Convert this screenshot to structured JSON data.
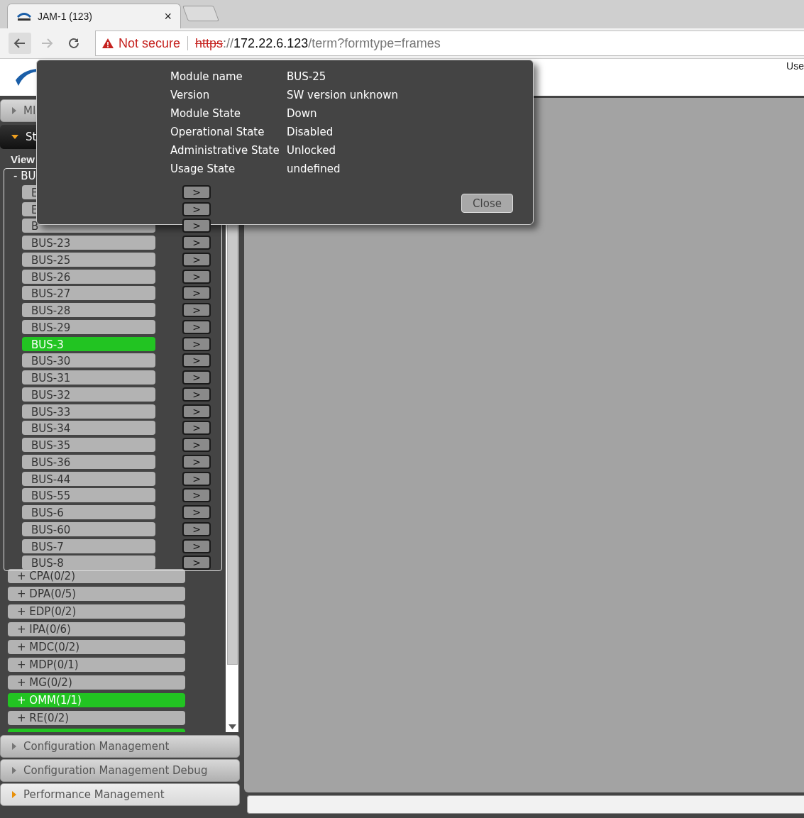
{
  "browser": {
    "tab": {
      "title": "JAM-1 (123)",
      "close": "×"
    },
    "address": {
      "warning": "Not secure",
      "scheme": "https",
      "separator": "://",
      "host": "172.22.6.123",
      "path": "/term?formtype=frames"
    }
  },
  "header": {
    "user_text": "Use"
  },
  "sidebar": {
    "sections_top": [
      {
        "label": "MI",
        "expanded": false
      },
      {
        "label": "St",
        "expanded": true
      }
    ],
    "view_label": "View",
    "tree": {
      "label": "- BU",
      "items": [
        {
          "label": "E",
          "action": ">",
          "selected": false
        },
        {
          "label": "E",
          "action": ">",
          "selected": false
        },
        {
          "label": "B",
          "action": ">",
          "selected": false
        },
        {
          "label": "BUS-23",
          "action": ">",
          "selected": false
        },
        {
          "label": "BUS-25",
          "action": ">",
          "selected": false
        },
        {
          "label": "BUS-26",
          "action": ">",
          "selected": false
        },
        {
          "label": "BUS-27",
          "action": ">",
          "selected": false
        },
        {
          "label": "BUS-28",
          "action": ">",
          "selected": false
        },
        {
          "label": "BUS-29",
          "action": ">",
          "selected": false
        },
        {
          "label": "BUS-3",
          "action": ">",
          "selected": true
        },
        {
          "label": "BUS-30",
          "action": ">",
          "selected": false
        },
        {
          "label": "BUS-31",
          "action": ">",
          "selected": false
        },
        {
          "label": "BUS-32",
          "action": ">",
          "selected": false
        },
        {
          "label": "BUS-33",
          "action": ">",
          "selected": false
        },
        {
          "label": "BUS-34",
          "action": ">",
          "selected": false
        },
        {
          "label": "BUS-35",
          "action": ">",
          "selected": false
        },
        {
          "label": "BUS-36",
          "action": ">",
          "selected": false
        },
        {
          "label": "BUS-44",
          "action": ">",
          "selected": false
        },
        {
          "label": "BUS-55",
          "action": ">",
          "selected": false
        },
        {
          "label": "BUS-6",
          "action": ">",
          "selected": false
        },
        {
          "label": "BUS-60",
          "action": ">",
          "selected": false
        },
        {
          "label": "BUS-7",
          "action": ">",
          "selected": false
        },
        {
          "label": "BUS-8",
          "action": ">",
          "selected": false
        }
      ]
    },
    "groups": [
      {
        "label": "+ CPA(0/2)",
        "selected": false
      },
      {
        "label": "+ DPA(0/5)",
        "selected": false
      },
      {
        "label": "+ EDP(0/2)",
        "selected": false
      },
      {
        "label": "+ IPA(0/6)",
        "selected": false
      },
      {
        "label": "+ MDC(0/2)",
        "selected": false
      },
      {
        "label": "+ MDP(0/1)",
        "selected": false
      },
      {
        "label": "+ MG(0/2)",
        "selected": false
      },
      {
        "label": "+ OMM(1/1)",
        "selected": true
      },
      {
        "label": "+ RE(0/2)",
        "selected": false
      },
      {
        "selected": true
      }
    ],
    "sections_bottom": [
      {
        "label": "Configuration Management",
        "highlighted": false
      },
      {
        "label": "Configuration Management Debug",
        "highlighted": false
      },
      {
        "label": "Performance Management",
        "highlighted": true
      }
    ]
  },
  "popup": {
    "rows": [
      {
        "label": "Module name",
        "value": "BUS-25"
      },
      {
        "label": "Version",
        "value": "SW version unknown"
      },
      {
        "label": "Module State",
        "value": "Down"
      },
      {
        "label": "Operational State",
        "value": "Disabled"
      },
      {
        "label": "Administrative State",
        "value": "Unlocked"
      },
      {
        "label": "Usage State",
        "value": "undefined"
      }
    ],
    "close_button": "Close"
  }
}
